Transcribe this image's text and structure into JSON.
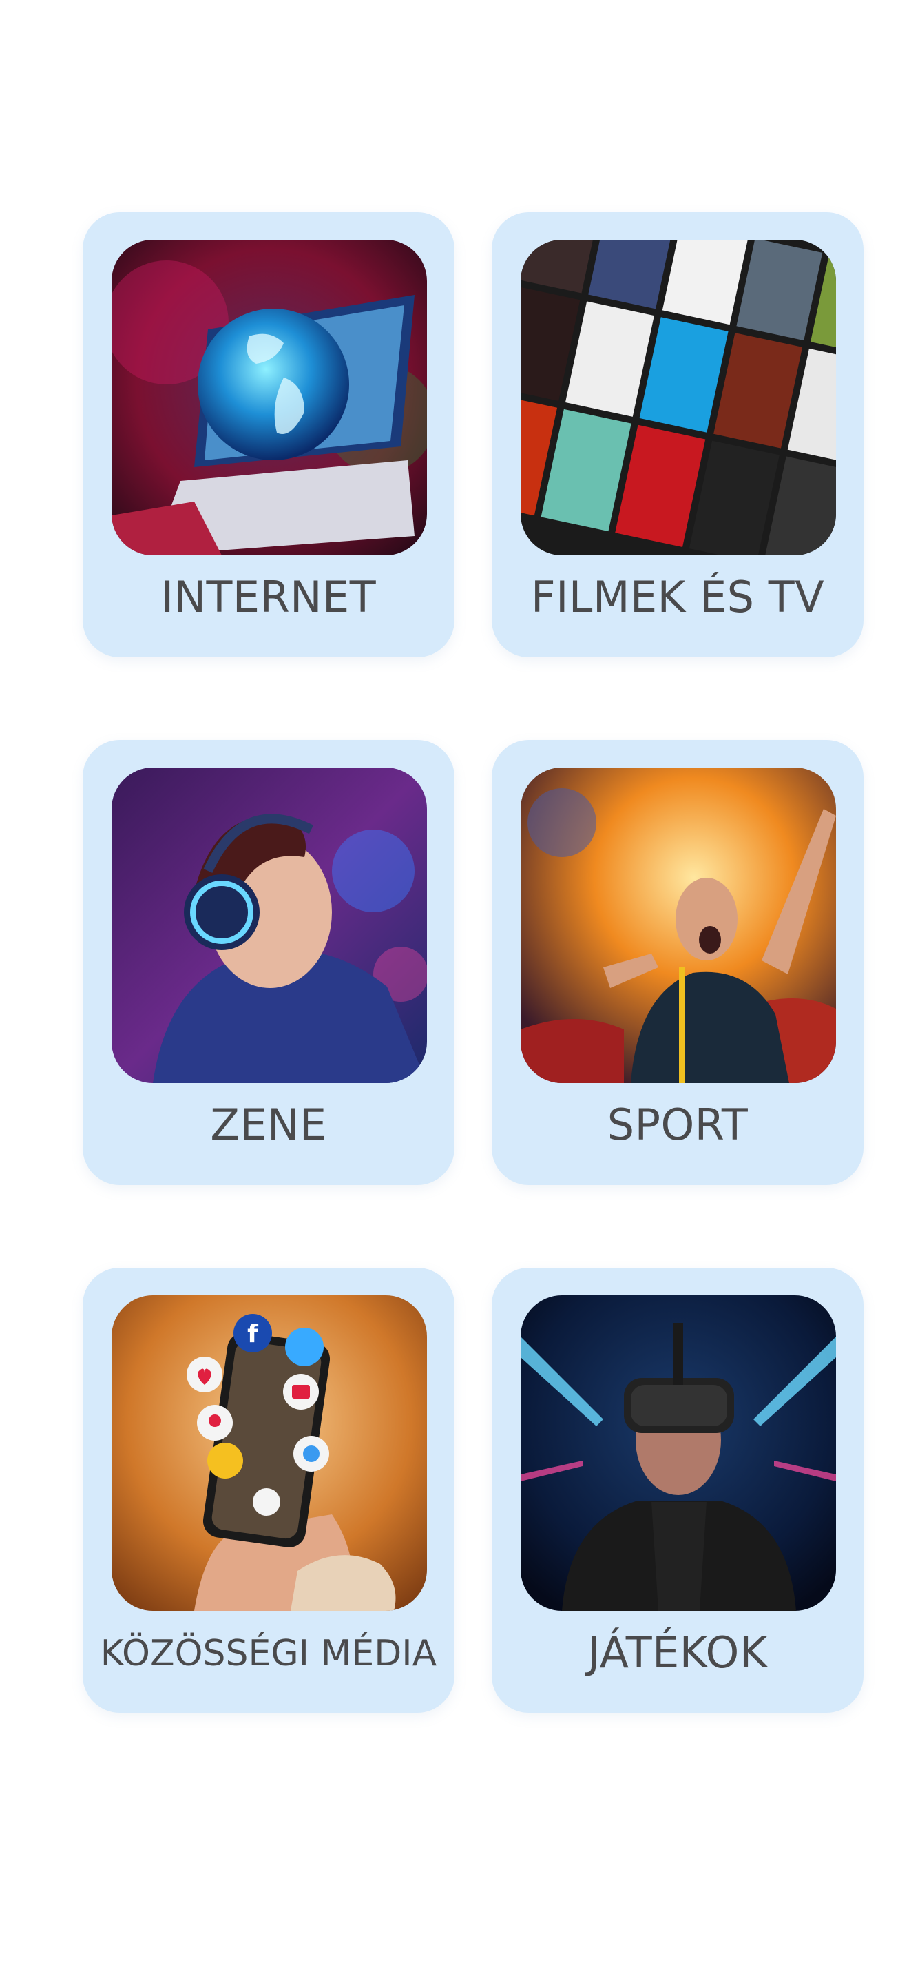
{
  "categories": [
    {
      "id": "internet",
      "label": "INTERNET"
    },
    {
      "id": "movies-tv",
      "label": "FILMEK ÉS TV"
    },
    {
      "id": "music",
      "label": "ZENE"
    },
    {
      "id": "sport",
      "label": "SPORT"
    },
    {
      "id": "social-media",
      "label": "KÖZÖSSÉGI MÉDIA"
    },
    {
      "id": "games",
      "label": "JÁTÉKOK"
    }
  ],
  "images": {
    "internet": "globe-laptop-image",
    "movies-tv": "movie-posters-image",
    "music": "headphones-listener-image",
    "sport": "cheering-fan-image",
    "social-media": "smartphone-social-icons-image",
    "games": "vr-headset-gamer-image"
  }
}
